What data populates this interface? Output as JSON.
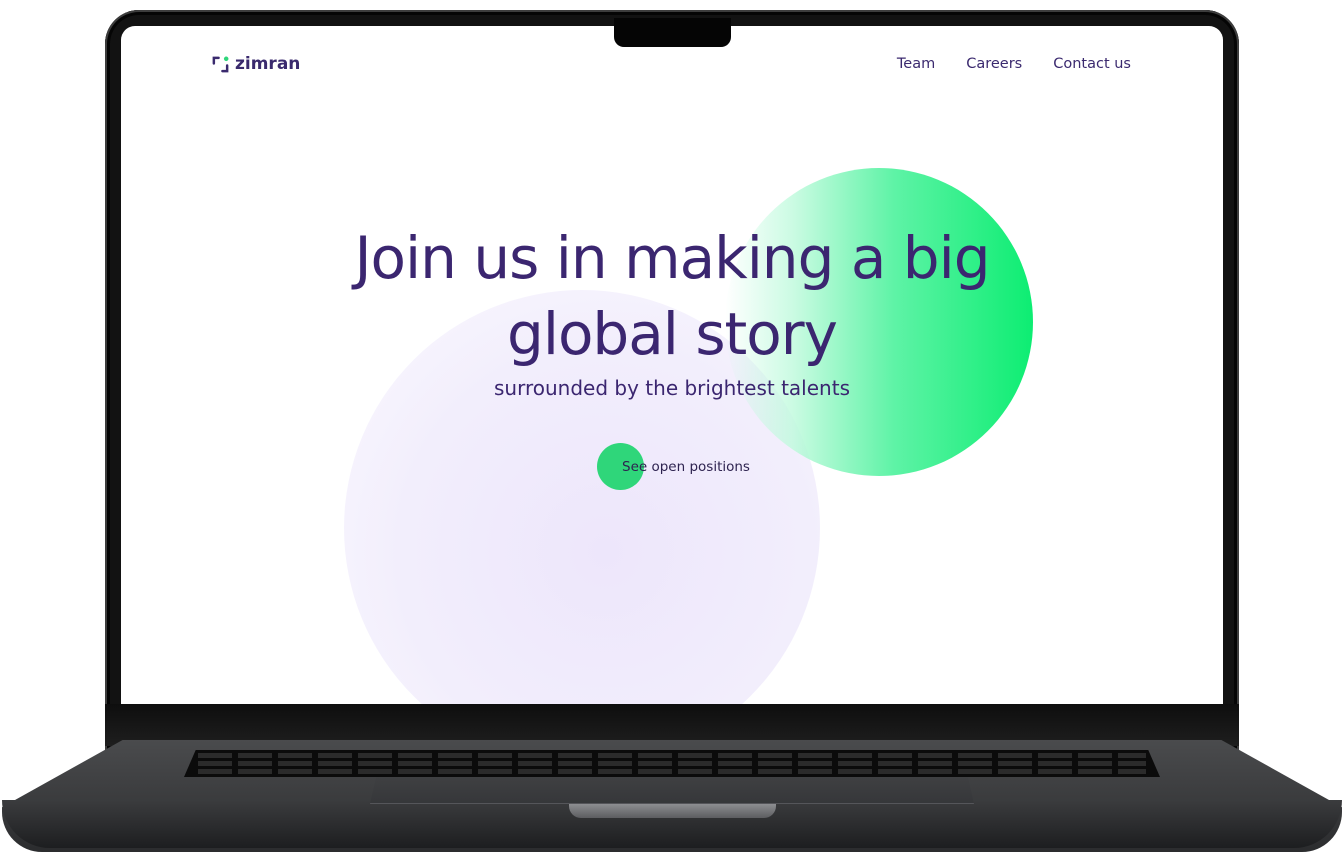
{
  "header": {
    "logo_text": "zimran",
    "logo_icon": "zimran-bracket-icon",
    "nav": [
      {
        "label": "Team"
      },
      {
        "label": "Careers"
      },
      {
        "label": "Contact us"
      }
    ]
  },
  "hero": {
    "title_line1": "Join us in making a big",
    "title_line2": "global story",
    "subtitle": "surrounded by the brightest talents",
    "cta_label": "See open positions"
  },
  "colors": {
    "brand_text": "#3b2670",
    "accent_green": "#2fd67a",
    "blob_green": "#0ded72",
    "blob_lilac": "#ede6fb"
  }
}
